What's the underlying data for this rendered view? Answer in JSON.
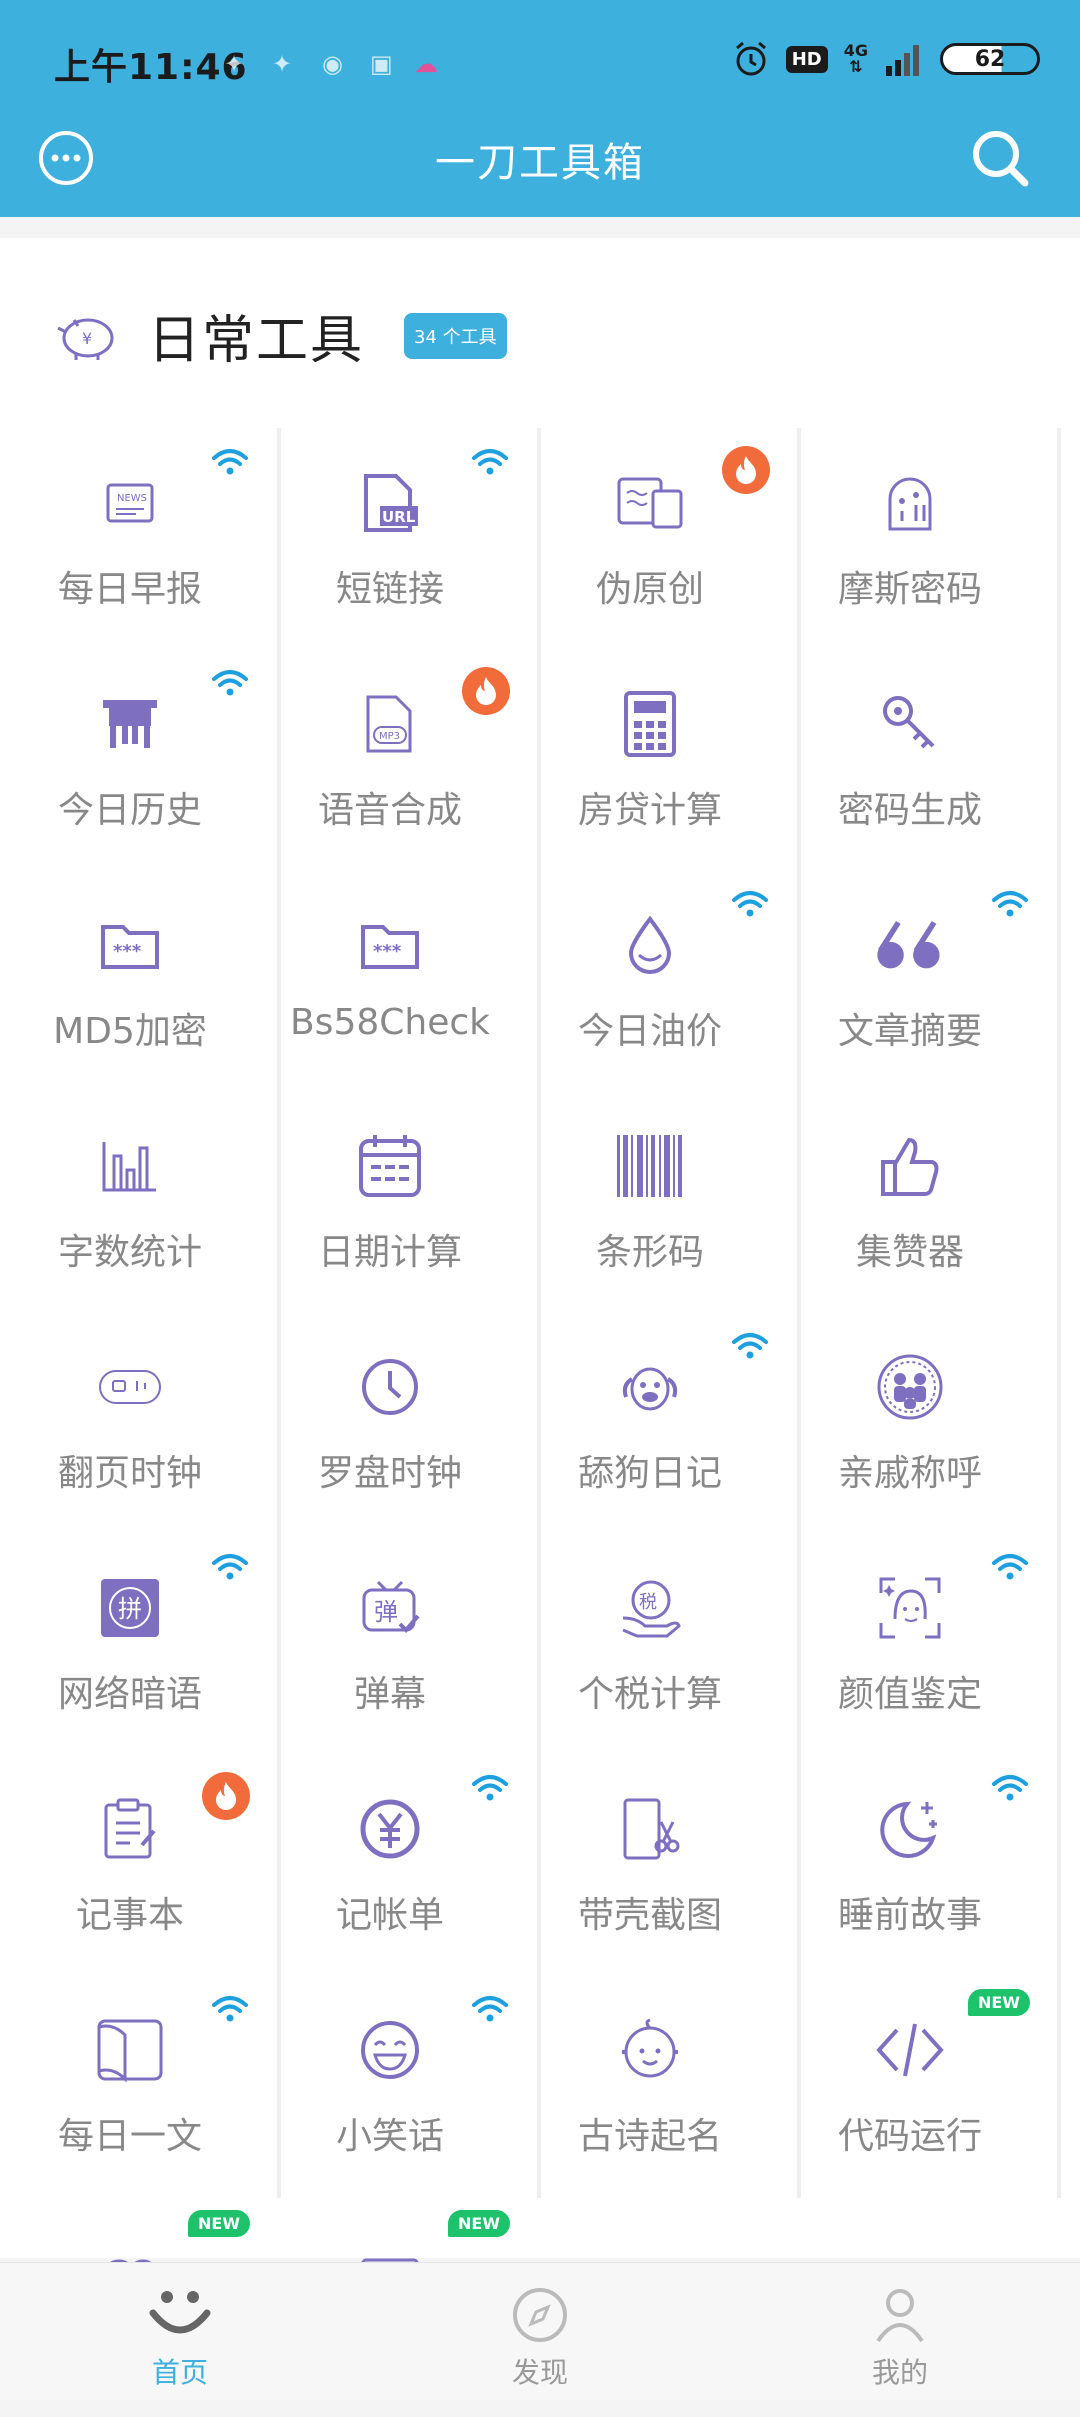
{
  "status_bar": {
    "time": "上午11:46",
    "network": "4G",
    "hd": "HD",
    "battery": "62"
  },
  "header": {
    "title": "一刀工具箱"
  },
  "section": {
    "title": "日常工具",
    "count_badge": "34 个工具"
  },
  "tools": [
    {
      "label": "每日早报",
      "icon": "newspaper-icon",
      "corner": "wifi"
    },
    {
      "label": "短链接",
      "icon": "url-file-icon",
      "corner": "wifi"
    },
    {
      "label": "伪原创",
      "icon": "document-icon",
      "corner": "fire"
    },
    {
      "label": "摩斯密码",
      "icon": "morse-icon",
      "corner": ""
    },
    {
      "label": "今日历史",
      "icon": "ancient-vessel-icon",
      "corner": "wifi"
    },
    {
      "label": "语音合成",
      "icon": "mp3-file-icon",
      "corner": "fire"
    },
    {
      "label": "房贷计算",
      "icon": "calculator-icon",
      "corner": ""
    },
    {
      "label": "密码生成",
      "icon": "key-icon",
      "corner": ""
    },
    {
      "label": "MD5加密",
      "icon": "folder-lock-icon",
      "corner": ""
    },
    {
      "label": "Bs58Check",
      "icon": "folder-lock-icon",
      "corner": ""
    },
    {
      "label": "今日油价",
      "icon": "oil-drop-icon",
      "corner": "wifi"
    },
    {
      "label": "文章摘要",
      "icon": "quote-icon",
      "corner": "wifi"
    },
    {
      "label": "字数统计",
      "icon": "bar-chart-icon",
      "corner": ""
    },
    {
      "label": "日期计算",
      "icon": "calendar-icon",
      "corner": ""
    },
    {
      "label": "条形码",
      "icon": "barcode-icon",
      "corner": ""
    },
    {
      "label": "集赞器",
      "icon": "thumbs-up-icon",
      "corner": ""
    },
    {
      "label": "翻页时钟",
      "icon": "flip-clock-icon",
      "corner": ""
    },
    {
      "label": "罗盘时钟",
      "icon": "clock-icon",
      "corner": ""
    },
    {
      "label": "舔狗日记",
      "icon": "dog-icon",
      "corner": "wifi"
    },
    {
      "label": "亲戚称呼",
      "icon": "family-icon",
      "corner": ""
    },
    {
      "label": "网络暗语",
      "icon": "pinyin-icon",
      "corner": "wifi"
    },
    {
      "label": "弹幕",
      "icon": "tv-bullet-icon",
      "corner": ""
    },
    {
      "label": "个税计算",
      "icon": "tax-icon",
      "corner": ""
    },
    {
      "label": "颜值鉴定",
      "icon": "face-scan-icon",
      "corner": "wifi"
    },
    {
      "label": "记事本",
      "icon": "notepad-icon",
      "corner": "fire"
    },
    {
      "label": "记帐单",
      "icon": "yuan-icon",
      "corner": "wifi"
    },
    {
      "label": "带壳截图",
      "icon": "phone-scissors-icon",
      "corner": ""
    },
    {
      "label": "睡前故事",
      "icon": "moon-icon",
      "corner": "wifi"
    },
    {
      "label": "每日一文",
      "icon": "book-icon",
      "corner": "wifi"
    },
    {
      "label": "小笑话",
      "icon": "laugh-icon",
      "corner": "wifi"
    },
    {
      "label": "古诗起名",
      "icon": "baby-icon",
      "corner": ""
    },
    {
      "label": "代码运行",
      "icon": "code-icon",
      "corner": "new"
    },
    {
      "label": "",
      "icon": "people-icon",
      "corner": "new"
    },
    {
      "label": "",
      "icon": "card-icon",
      "corner": "new"
    }
  ],
  "new_label": "NEW",
  "bottom_nav": [
    {
      "label": "首页",
      "icon": "smile-icon",
      "active": true
    },
    {
      "label": "发现",
      "icon": "compass-icon",
      "active": false
    },
    {
      "label": "我的",
      "icon": "person-icon",
      "active": false
    }
  ],
  "colors": {
    "header": "#3db0de",
    "icon": "#7e6fc0",
    "wifi": "#1d9fe0",
    "fire": "#f26b3a",
    "new": "#1ec26a"
  }
}
